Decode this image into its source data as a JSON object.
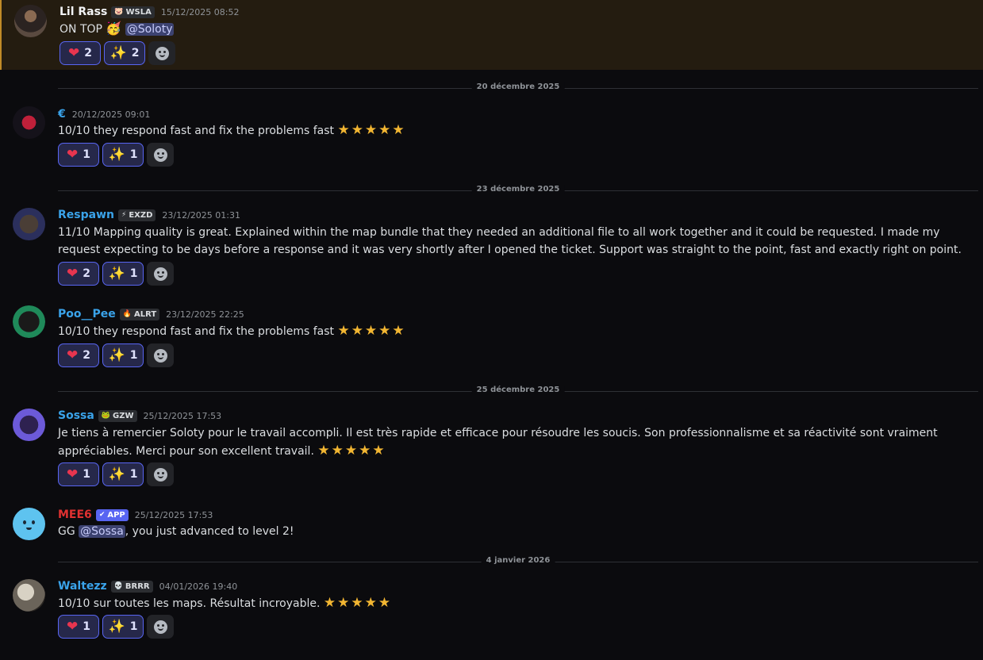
{
  "messages": [
    {
      "username": "Lil Rass",
      "username_color": "#f2f3f5",
      "tag": {
        "icon": "🐷",
        "text": "WSLA"
      },
      "timestamp": "15/12/2025 08:52",
      "content_text": "ON TOP",
      "content_emoji": "🥳",
      "mention": "@Soloty",
      "reactions": {
        "heart_count": "2",
        "sparkle_count": "2"
      },
      "highlighted": true
    },
    {
      "username": "€",
      "username_color": "#3aa3ea",
      "timestamp": "20/12/2025 09:01",
      "content_text": "10/10 they respond fast and fix the problems fast",
      "stars": "★★★★★",
      "reactions": {
        "heart_count": "1",
        "sparkle_count": "1"
      }
    },
    {
      "username": "Respawn",
      "username_color": "#3aa3ea",
      "tag": {
        "icon": "⚡",
        "text": "EXZD"
      },
      "timestamp": "23/12/2025 01:31",
      "content_text": "11/10 Mapping quality is great. Explained within the map bundle that they needed an additional file to all work together and it could be requested. I made my request expecting to be days before a response and it was very shortly after I opened the ticket. Support was straight to the point, fast and exactly right on point.",
      "reactions": {
        "heart_count": "2",
        "sparkle_count": "1"
      }
    },
    {
      "username": "Poo__Pee",
      "username_color": "#3aa3ea",
      "tag": {
        "icon": "🔥",
        "text": "ALRT"
      },
      "timestamp": "23/12/2025 22:25",
      "content_text": "10/10 they respond fast and fix the problems fast",
      "stars": "★★★★★",
      "reactions": {
        "heart_count": "2",
        "sparkle_count": "1"
      }
    },
    {
      "username": "Sossa",
      "username_color": "#3aa3ea",
      "tag": {
        "icon": "🐸",
        "text": "GZW"
      },
      "timestamp": "25/12/2025 17:53",
      "content_text": "Je tiens à remercier Soloty pour le travail accompli. Il est très rapide et efficace pour résoudre les soucis. Son professionnalisme et sa réactivité sont vraiment appréciables. Merci pour son excellent travail.",
      "stars": "★★★★★",
      "reactions": {
        "heart_count": "1",
        "sparkle_count": "1"
      }
    },
    {
      "username": "MEE6",
      "username_color": "#e03131",
      "tag": {
        "icon": "✔",
        "text": "APP"
      },
      "timestamp": "25/12/2025 17:53",
      "content_prefix": "GG",
      "mention": "@Sossa",
      "content_suffix": ", you just advanced to level 2!"
    },
    {
      "username": "Waltezz",
      "username_color": "#3aa3ea",
      "tag": {
        "icon": "💀",
        "text": "BRRR"
      },
      "timestamp": "04/01/2026 19:40",
      "content_text": "10/10 sur toutes les maps. Résultat incroyable.",
      "stars": "★★★★★",
      "reactions": {
        "heart_count": "1",
        "sparkle_count": "1"
      }
    }
  ],
  "dividers": [
    "20 décembre 2025",
    "23 décembre 2025",
    "25 décembre 2025",
    "4 janvier 2026"
  ],
  "icons": {
    "heart": "heart-emoji-icon",
    "sparkle": "sparkles-emoji-icon",
    "add_reaction": "add-reaction-icon"
  }
}
